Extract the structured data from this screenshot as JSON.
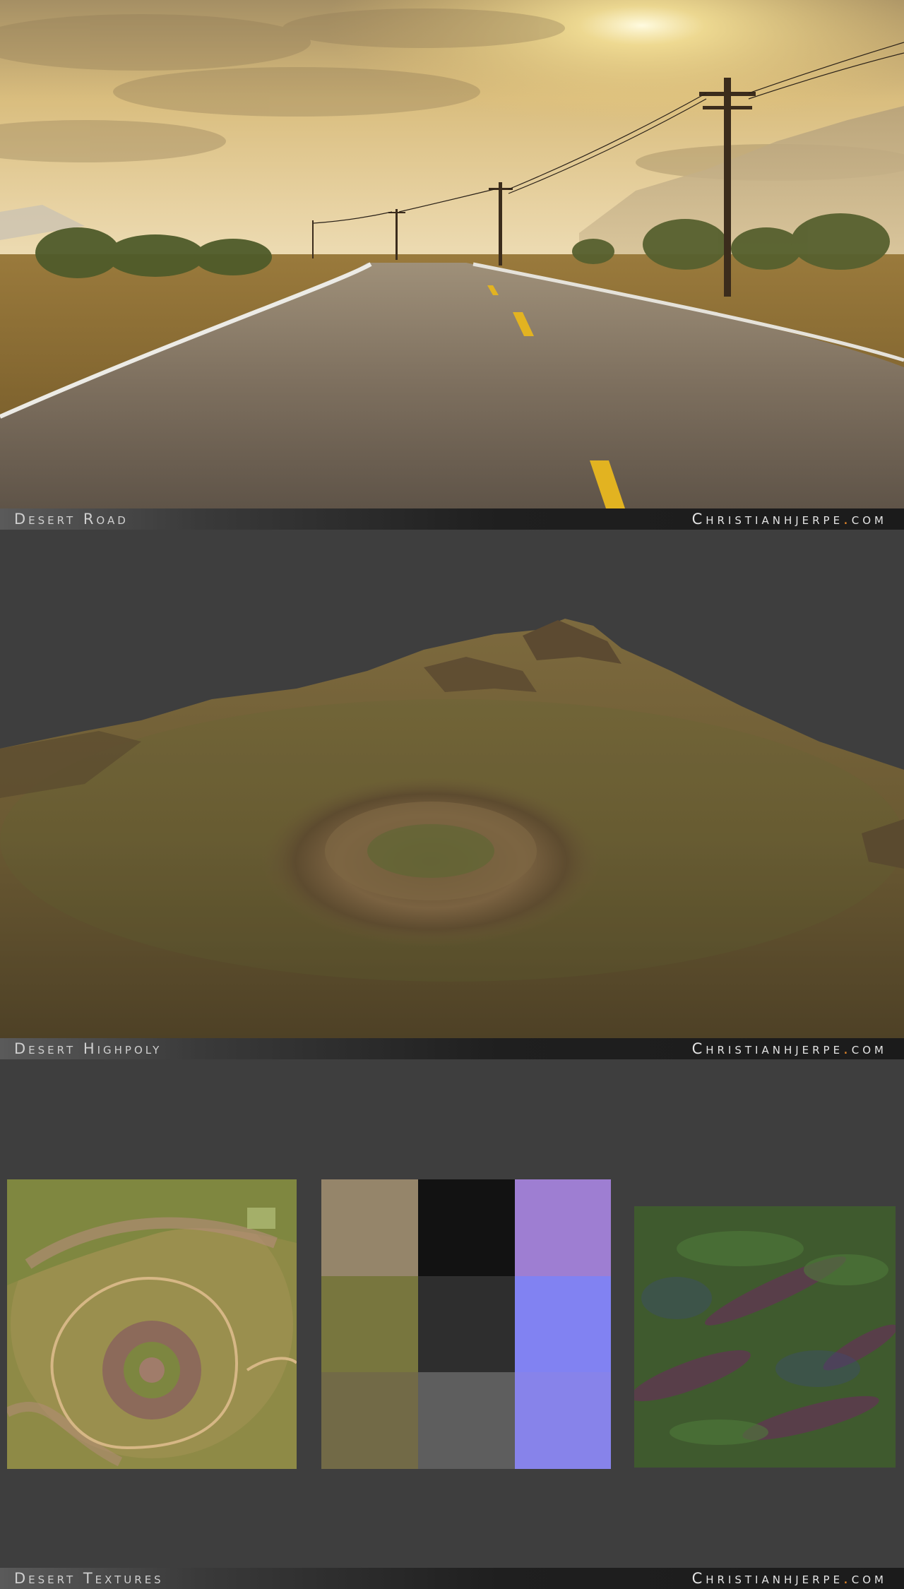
{
  "sections": [
    {
      "title": "Desert Road",
      "site_name": "Christianhjerpe",
      "site_dot": ".",
      "site_tld": "com"
    },
    {
      "title": "Desert Highpoly",
      "site_name": "Christianhjerpe",
      "site_dot": ".",
      "site_tld": "com"
    },
    {
      "title": "Desert Textures",
      "site_name": "Christianhjerpe",
      "site_dot": ".",
      "site_tld": "com"
    }
  ],
  "colors": {
    "background": "#3e3e3e",
    "accent_dot": "#e8882a",
    "road_line_yellow": "#e2b321",
    "sky_gold": "#e7c878"
  }
}
